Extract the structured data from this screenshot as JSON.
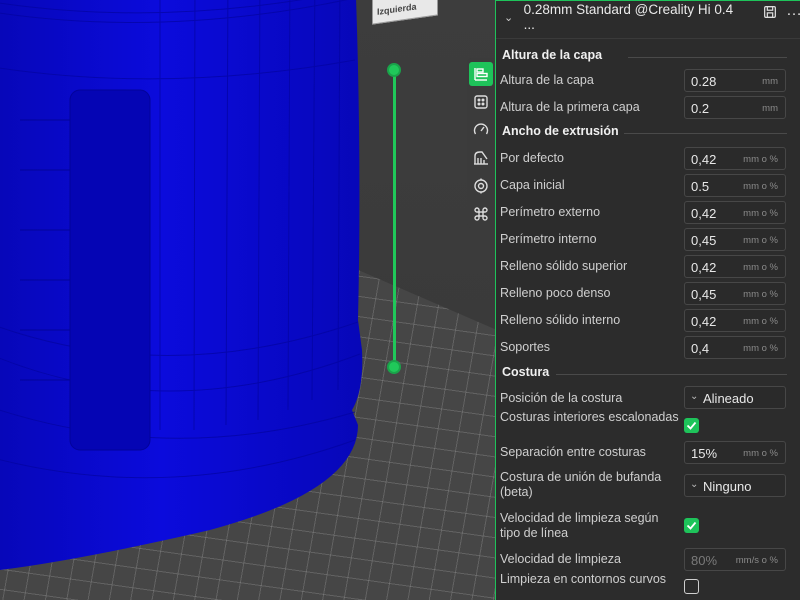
{
  "viewport": {
    "orientation_label": "Izquierda"
  },
  "profile": {
    "name": "0.28mm Standard @Creality Hi 0.4 ..."
  },
  "toolbar": [
    {
      "icon": "layers-icon",
      "active": true
    },
    {
      "icon": "infill-icon",
      "active": false
    },
    {
      "icon": "speed-icon",
      "active": false
    },
    {
      "icon": "support-icon",
      "active": false
    },
    {
      "icon": "filament-settings-icon",
      "active": false
    },
    {
      "icon": "others-icon",
      "active": false
    }
  ],
  "sections": [
    {
      "title": "Altura de la capa"
    },
    {
      "title": "Ancho de extrusión"
    },
    {
      "title": "Costura"
    }
  ],
  "settings": {
    "layer_height": {
      "label": "Altura de la capa",
      "value": "0.28",
      "unit": "mm"
    },
    "first_layer_height": {
      "label": "Altura de la primera capa",
      "value": "0.2",
      "unit": "mm"
    },
    "default_width": {
      "label": "Por defecto",
      "value": "0,42",
      "unit": "mm o %"
    },
    "initial_layer": {
      "label": "Capa inicial",
      "value": "0.5",
      "unit": "mm o %"
    },
    "outer_wall": {
      "label": "Perímetro externo",
      "value": "0,42",
      "unit": "mm o %"
    },
    "inner_wall": {
      "label": "Perímetro interno",
      "value": "0,45",
      "unit": "mm o %"
    },
    "top_surface": {
      "label": "Relleno sólido superior",
      "value": "0,42",
      "unit": "mm o %"
    },
    "sparse_infill": {
      "label": "Relleno poco denso",
      "value": "0,45",
      "unit": "mm o %"
    },
    "internal_solid": {
      "label": "Relleno sólido interno",
      "value": "0,42",
      "unit": "mm o %"
    },
    "support": {
      "label": "Soportes",
      "value": "0,4",
      "unit": "mm o %"
    },
    "seam_position": {
      "label": "Posición de la costura",
      "value": "Alineado"
    },
    "staggered_seams": {
      "label": "Costuras interiores escalonadas",
      "checked": true
    },
    "seam_gap": {
      "label": "Separación entre costuras",
      "value": "15%",
      "unit": "mm o %"
    },
    "scarf_seam": {
      "label": "Costura de unión de bufanda (beta)",
      "value": "Ninguno"
    },
    "wipe_speed_by_line": {
      "label": "Velocidad de limpieza según tipo de línea",
      "checked": true
    },
    "wipe_speed": {
      "label": "Velocidad de limpieza",
      "value": "80%",
      "unit": "mm/s o %"
    },
    "wipe_on_curves": {
      "label": "Limpieza en contornos curvos",
      "checked": false
    }
  },
  "colors": {
    "accent": "#1ec35a",
    "model": "#0a0ad8",
    "panel_bg": "#2c2c2c"
  }
}
